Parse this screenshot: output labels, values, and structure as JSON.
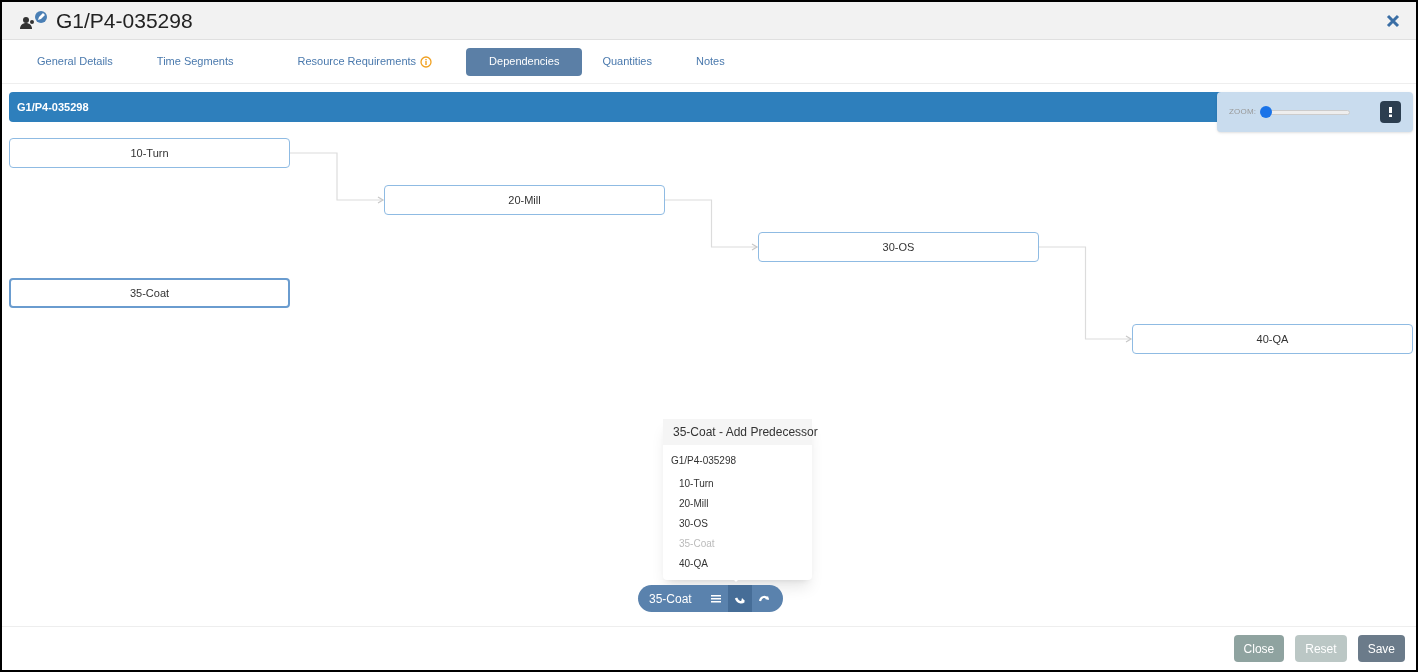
{
  "window": {
    "title": "G1/P4-035298"
  },
  "tabs": [
    {
      "label": "General Details",
      "selected": false,
      "info": false
    },
    {
      "label": "Time Segments",
      "selected": false,
      "info": false
    },
    {
      "label": "Resource Requirements",
      "selected": false,
      "info": true
    },
    {
      "label": "Dependencies",
      "selected": true,
      "info": false
    },
    {
      "label": "Quantities",
      "selected": false,
      "info": false
    },
    {
      "label": "Notes",
      "selected": false,
      "info": false
    }
  ],
  "group_bar": {
    "label": "G1/P4-035298"
  },
  "zoom": {
    "label": "ZOOM:",
    "level": 0
  },
  "nodes": [
    {
      "label": "10-Turn",
      "selected": false
    },
    {
      "label": "20-Mill",
      "selected": false
    },
    {
      "label": "30-OS",
      "selected": false
    },
    {
      "label": "35-Coat",
      "selected": true
    },
    {
      "label": "40-QA",
      "selected": false
    }
  ],
  "predecessor_menu": {
    "title": "35-Coat - Add Predecessor",
    "group": "G1/P4-035298",
    "items": [
      {
        "label": "10-Turn",
        "disabled": false
      },
      {
        "label": "20-Mill",
        "disabled": false
      },
      {
        "label": "30-OS",
        "disabled": false
      },
      {
        "label": "35-Coat",
        "disabled": true
      },
      {
        "label": "40-QA",
        "disabled": false
      }
    ]
  },
  "node_toolbar": {
    "label": "35-Coat",
    "actions": [
      {
        "kind": "list",
        "selected": false
      },
      {
        "kind": "predecessor",
        "selected": true
      },
      {
        "kind": "successor",
        "selected": false
      }
    ]
  },
  "buttons": [
    {
      "label": "Close",
      "kind": "close",
      "disabled": false
    },
    {
      "label": "Reset",
      "kind": "reset",
      "disabled": true
    },
    {
      "label": "Save",
      "kind": "save",
      "disabled": false
    }
  ]
}
